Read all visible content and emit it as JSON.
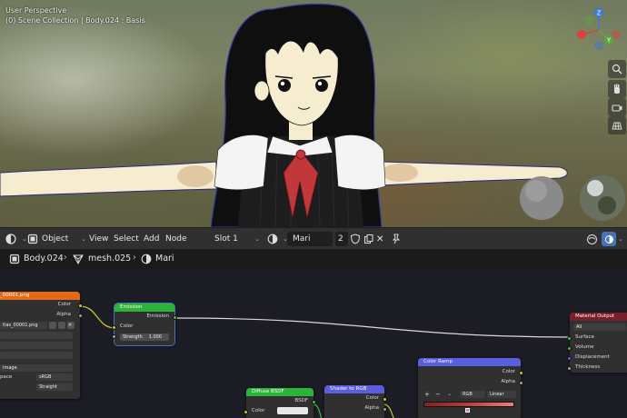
{
  "viewport": {
    "line1": "User Perspective",
    "line2": "(0) Scene Collection | Body.024 : Basis",
    "gizmo": {
      "x": "X",
      "y": "Y",
      "z": "Z"
    },
    "tools": [
      "zoom-icon",
      "hand-icon",
      "camera-icon",
      "grid-icon"
    ]
  },
  "header": {
    "mode": "Object",
    "menus": [
      "View",
      "Select",
      "Add",
      "Node"
    ],
    "slot": "Slot 1",
    "material": "Mari",
    "users": "2"
  },
  "breadcrumb": {
    "object": "Body.024",
    "mesh": "mesh.025",
    "material": "Mari"
  },
  "nodes": {
    "image_texture": {
      "title": "_00001.png",
      "out_color": "Color",
      "out_alpha": "Alpha",
      "image_name": "tlas_00001.png",
      "proj": "Image",
      "space_label": "pace",
      "space_value": "sRGB",
      "alpha_mode": "Straight"
    },
    "emission": {
      "title": "Emission",
      "out": "Emission",
      "in_color": "Color",
      "strength_label": "Strength",
      "strength_value": "1.000"
    },
    "material_output": {
      "title": "Material Output",
      "target": "All",
      "surface": "Surface",
      "volume": "Volume",
      "displacement": "Displacement",
      "thickness": "Thickness"
    },
    "diffuse": {
      "title": "Diffuse BSDF",
      "out": "BSDF",
      "in_color": "Color"
    },
    "shader_to_rgb": {
      "title": "Shader to RGB",
      "out_color": "Color",
      "out_alpha": "Alpha"
    },
    "color_ramp": {
      "title": "Color Ramp",
      "out_color": "Color",
      "out_alpha": "Alpha",
      "mode": "RGB",
      "interp": "Linear",
      "add": "+",
      "remove": "−"
    }
  },
  "colors": {
    "accent_blue": "#4772b3",
    "image_node": "#e06a16",
    "shader_node": "#2cb33a",
    "vector_node": "#5a5fe0",
    "output_node": "#7a1f2a"
  }
}
